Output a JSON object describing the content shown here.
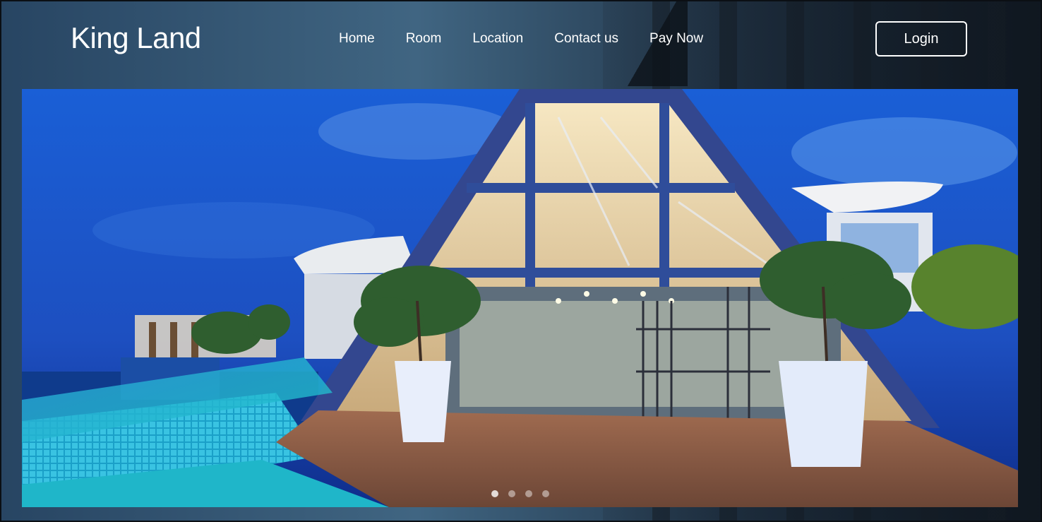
{
  "brand": {
    "name": "King Land"
  },
  "nav": {
    "items": [
      {
        "label": "Home"
      },
      {
        "label": "Room"
      },
      {
        "label": "Location"
      },
      {
        "label": "Contact us"
      },
      {
        "label": "Pay Now"
      }
    ]
  },
  "auth": {
    "login_label": "Login"
  },
  "hero": {
    "image_icon": "hotel-pavilion-photo",
    "slides": 4,
    "active_slide": 1
  },
  "colors": {
    "text": "#ffffff",
    "sky": "#1757c8",
    "pool": "#25b8d6",
    "deck": "#8a5a44",
    "frame": "#2f4d9a"
  }
}
